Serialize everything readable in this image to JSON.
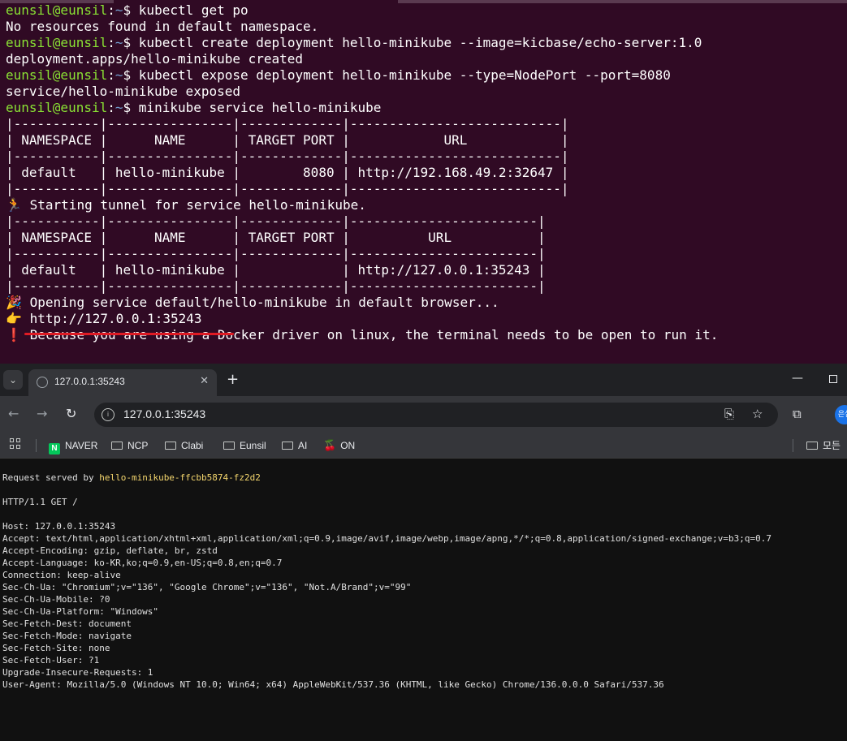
{
  "terminal": {
    "prompt": {
      "user": "eunsil@eunsil",
      "path": "~",
      "symbol": "$"
    },
    "lines": [
      {
        "type": "cmd",
        "text": "kubectl get po"
      },
      {
        "type": "out",
        "text": "No resources found in default namespace."
      },
      {
        "type": "cmd",
        "text": "kubectl create deployment hello-minikube --image=kicbase/echo-server:1.0"
      },
      {
        "type": "out",
        "text": "deployment.apps/hello-minikube created"
      },
      {
        "type": "cmd",
        "text": "kubectl expose deployment hello-minikube --type=NodePort --port=8080"
      },
      {
        "type": "out",
        "text": "service/hello-minikube exposed"
      },
      {
        "type": "cmd",
        "text": "minikube service hello-minikube"
      },
      {
        "type": "out",
        "text": "|-----------|----------------|-------------|---------------------------|"
      },
      {
        "type": "out",
        "text": "| NAMESPACE |      NAME      | TARGET PORT |            URL            |"
      },
      {
        "type": "out",
        "text": "|-----------|----------------|-------------|---------------------------|"
      },
      {
        "type": "out",
        "text": "| default   | hello-minikube |        8080 | http://192.168.49.2:32647 |"
      },
      {
        "type": "out",
        "text": "|-----------|----------------|-------------|---------------------------|"
      },
      {
        "type": "emoji",
        "icon": "🏃",
        "text": "Starting tunnel for service hello-minikube."
      },
      {
        "type": "out",
        "text": "|-----------|----------------|-------------|------------------------|"
      },
      {
        "type": "out",
        "text": "| NAMESPACE |      NAME      | TARGET PORT |          URL           |"
      },
      {
        "type": "out",
        "text": "|-----------|----------------|-------------|------------------------|"
      },
      {
        "type": "out",
        "text": "| default   | hello-minikube |             | http://127.0.0.1:35243 |"
      },
      {
        "type": "out",
        "text": "|-----------|----------------|-------------|------------------------|"
      },
      {
        "type": "emoji",
        "icon": "🎉",
        "text": "Opening service default/hello-minikube in default browser..."
      },
      {
        "type": "emoji",
        "icon": "👉",
        "text": "http://127.0.0.1:35243"
      },
      {
        "type": "emoji",
        "icon": "❗",
        "text": "Because you are using a Docker driver on linux, the terminal needs to be open to run it."
      }
    ]
  },
  "browser": {
    "tab_title": "127.0.0.1:35243",
    "url": "127.0.0.1:35243",
    "bookmarks": [
      "NAVER",
      "NCP",
      "Clabi",
      "Eunsil",
      "AI",
      "ON"
    ],
    "other_bookmarks": "모든",
    "profile": "은실",
    "colors": {
      "highlight": "#f5d76e",
      "page_bg": "#111111"
    }
  },
  "page": {
    "served_by_prefix": "Request served by ",
    "served_by_host": "hello-minikube-ffcbb5874-fz2d2",
    "request_line": "HTTP/1.1 GET /",
    "headers": [
      "Host: 127.0.0.1:35243",
      "Accept: text/html,application/xhtml+xml,application/xml;q=0.9,image/avif,image/webp,image/apng,*/*;q=0.8,application/signed-exchange;v=b3;q=0.7",
      "Accept-Encoding: gzip, deflate, br, zstd",
      "Accept-Language: ko-KR,ko;q=0.9,en-US;q=0.8,en;q=0.7",
      "Connection: keep-alive",
      "Sec-Ch-Ua: \"Chromium\";v=\"136\", \"Google Chrome\";v=\"136\", \"Not.A/Brand\";v=\"99\"",
      "Sec-Ch-Ua-Mobile: ?0",
      "Sec-Ch-Ua-Platform: \"Windows\"",
      "Sec-Fetch-Dest: document",
      "Sec-Fetch-Mode: navigate",
      "Sec-Fetch-Site: none",
      "Sec-Fetch-User: ?1",
      "Upgrade-Insecure-Requests: 1",
      "User-Agent: Mozilla/5.0 (Windows NT 10.0; Win64; x64) AppleWebKit/537.36 (KHTML, like Gecko) Chrome/136.0.0.0 Safari/537.36"
    ]
  }
}
